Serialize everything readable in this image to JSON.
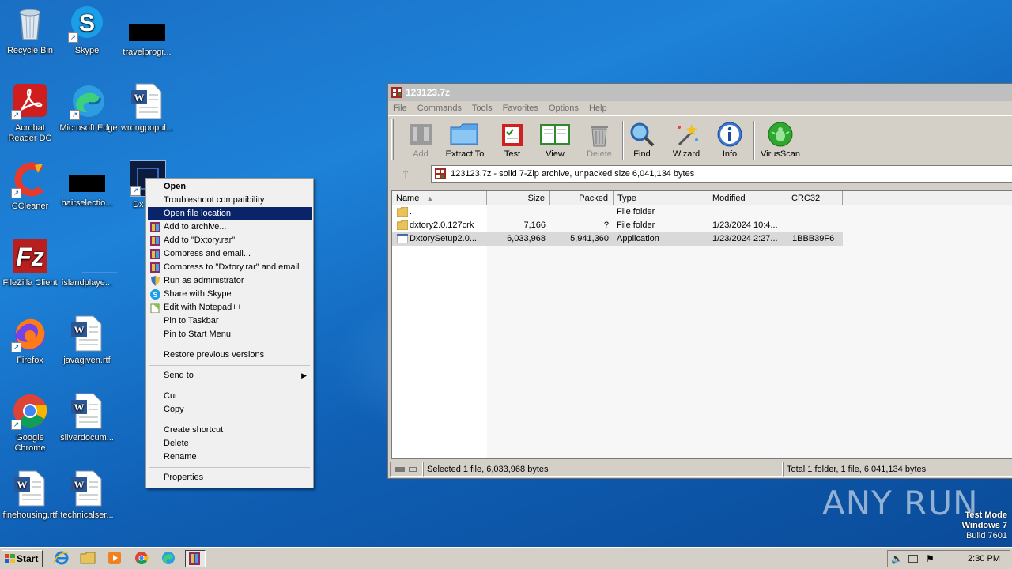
{
  "desktop": {
    "icons": [
      {
        "label": "Recycle Bin"
      },
      {
        "label": "Skype"
      },
      {
        "label": "travelprogr..."
      },
      {
        "label": "Acrobat Reader DC"
      },
      {
        "label": "Microsoft Edge"
      },
      {
        "label": "wrongpopul..."
      },
      {
        "label": "CCleaner"
      },
      {
        "label": "hairselectio..."
      },
      {
        "label": "Dx"
      },
      {
        "label": "FileZilla Client"
      },
      {
        "label": "islandplaye..."
      },
      {
        "label": "Firefox"
      },
      {
        "label": "javagiven.rtf"
      },
      {
        "label": "Google Chrome"
      },
      {
        "label": "silverdocum..."
      },
      {
        "label": "finehousing.rtf"
      },
      {
        "label": "technicalser..."
      }
    ]
  },
  "context_menu": {
    "items": [
      {
        "label": "Open"
      },
      {
        "label": "Troubleshoot compatibility"
      },
      {
        "label": "Open file location"
      },
      {
        "label": "Add to archive..."
      },
      {
        "label": "Add to \"Dxtory.rar\""
      },
      {
        "label": "Compress and email..."
      },
      {
        "label": "Compress to \"Dxtory.rar\" and email"
      },
      {
        "label": "Run as administrator"
      },
      {
        "label": "Share with Skype"
      },
      {
        "label": "Edit with Notepad++"
      },
      {
        "label": "Pin to Taskbar"
      },
      {
        "label": "Pin to Start Menu"
      },
      {
        "label": "Restore previous versions"
      },
      {
        "label": "Send to"
      },
      {
        "label": "Cut"
      },
      {
        "label": "Copy"
      },
      {
        "label": "Create shortcut"
      },
      {
        "label": "Delete"
      },
      {
        "label": "Rename"
      },
      {
        "label": "Properties"
      }
    ]
  },
  "window": {
    "title": "123123.7z",
    "menu": [
      "File",
      "Commands",
      "Tools",
      "Favorites",
      "Options",
      "Help"
    ],
    "toolbar": [
      "Add",
      "Extract To",
      "Test",
      "View",
      "Delete",
      "Find",
      "Wizard",
      "Info",
      "VirusScan"
    ],
    "address": "123123.7z - solid 7-Zip archive, unpacked size 6,041,134 bytes",
    "columns": [
      "Name",
      "Size",
      "Packed",
      "Type",
      "Modified",
      "CRC32"
    ],
    "rows": [
      {
        "name": "..",
        "size": "",
        "packed": "",
        "type": "File folder",
        "modified": "",
        "crc": ""
      },
      {
        "name": "dxtory2.0.127crk",
        "size": "7,166",
        "packed": "?",
        "type": "File folder",
        "modified": "1/23/2024 10:4...",
        "crc": ""
      },
      {
        "name": "DxtorySetup2.0....",
        "size": "6,033,968",
        "packed": "5,941,360",
        "type": "Application",
        "modified": "1/23/2024 2:27...",
        "crc": "1BBB39F6"
      }
    ],
    "status_left": "Selected 1 file, 6,033,968 bytes",
    "status_right": "Total 1 folder, 1 file, 6,041,134 bytes"
  },
  "taskbar": {
    "start_label": "Start",
    "clock": "2:30 PM"
  },
  "watermark": {
    "brand": "ANY RUN",
    "mode": "Test Mode",
    "os": "Windows 7",
    "build": "Build 7601"
  }
}
